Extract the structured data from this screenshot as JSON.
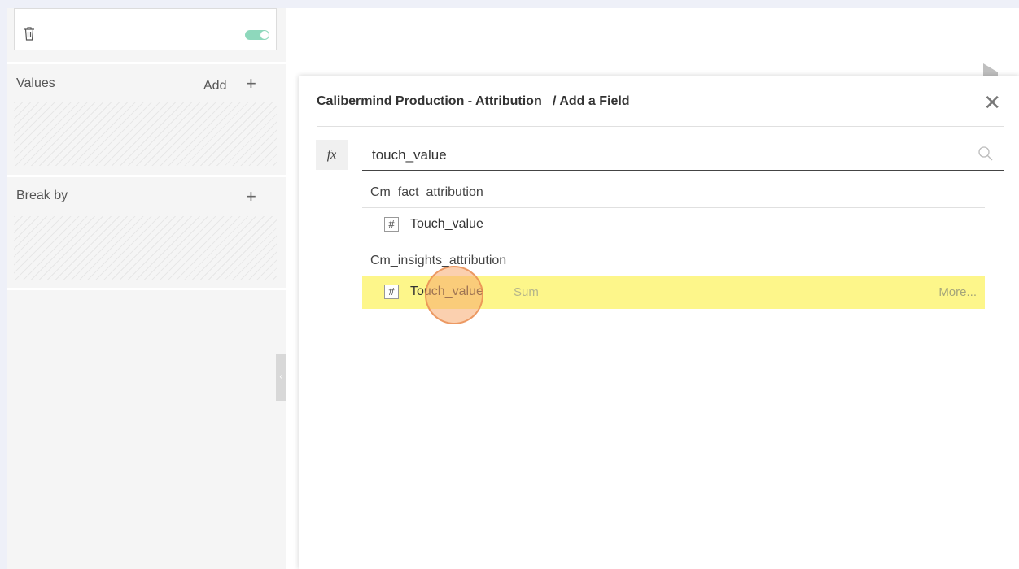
{
  "filter_card": {
    "icons": {
      "trash": "trash-icon",
      "toggle": "toggle-switch"
    },
    "toggle_on": true,
    "accent_color": "#8ed8bc"
  },
  "values_section": {
    "title": "Values",
    "add_label": "Add",
    "plus": "+"
  },
  "break_by_section": {
    "title": "Break by",
    "plus": "+"
  },
  "dialog": {
    "breadcrumb": "Calibermind Production - Attribution   / Add a Field",
    "close": "✕",
    "fx": "fx",
    "search": {
      "value": "touch_value",
      "icon": "search-icon"
    },
    "groups": [
      {
        "label": "Cm_fact_attribution",
        "fields": [
          {
            "type": "#",
            "name": "Touch_value"
          }
        ]
      },
      {
        "label": "Cm_insights_attribution",
        "fields": [
          {
            "type": "#",
            "name": "Touch_value",
            "aggregation": "Sum",
            "more": "More...",
            "highlighted": true
          }
        ]
      }
    ],
    "highlight_color": "#fdf68a"
  },
  "collapse_handle": "‹"
}
